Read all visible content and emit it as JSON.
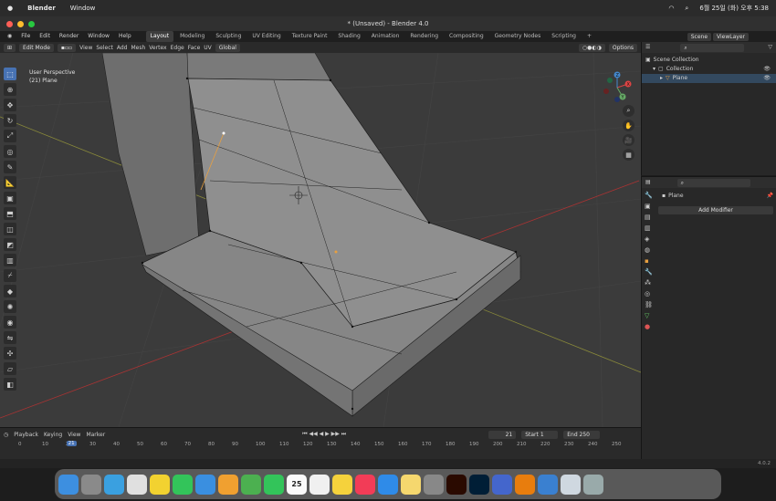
{
  "mac_menu": {
    "apple": "",
    "app": "Blender",
    "window": "Window",
    "clock": "6월 25일 (화) 오후 5:38"
  },
  "window_title": "* (Unsaved) - Blender 4.0",
  "menus": [
    "File",
    "Edit",
    "Render",
    "Window",
    "Help"
  ],
  "workspaces": [
    "Layout",
    "Modeling",
    "Sculpting",
    "UV Editing",
    "Texture Paint",
    "Shading",
    "Animation",
    "Rendering",
    "Compositing",
    "Geometry Nodes",
    "Scripting"
  ],
  "active_workspace": "Layout",
  "scene": "Scene",
  "view_layer": "ViewLayer",
  "header": {
    "mode": "Edit Mode",
    "view": "View",
    "select": "Select",
    "add": "Add",
    "mesh": "Mesh",
    "vertex": "Vertex",
    "edge": "Edge",
    "face": "Face",
    "uv": "UV",
    "orientation": "Global",
    "options": "Options"
  },
  "viewport": {
    "line1": "User Perspective",
    "line2": "(21) Plane",
    "axes": {
      "x": "X",
      "y": "Y",
      "z": "Z"
    }
  },
  "outliner": {
    "scene_collection": "Scene Collection",
    "collection": "Collection",
    "plane": "Plane"
  },
  "properties": {
    "object": "Plane",
    "add_modifier": "Add Modifier"
  },
  "timeline": {
    "playback": "Playback",
    "keying": "Keying",
    "view": "View",
    "marker": "Marker",
    "current": "21",
    "start_label": "Start",
    "start": "1",
    "end_label": "End",
    "end": "250",
    "ticks": [
      "0",
      "10",
      "20",
      "30",
      "40",
      "50",
      "60",
      "70",
      "80",
      "90",
      "100",
      "110",
      "120",
      "130",
      "140",
      "150",
      "160",
      "170",
      "180",
      "190",
      "200",
      "210",
      "220",
      "230",
      "240",
      "250"
    ],
    "playhead": "21"
  },
  "status": {
    "version": "4.0.2"
  },
  "dock": [
    "Finder",
    "Launchpad",
    "Safari",
    "Chrome",
    "KakaoTalk",
    "Messages",
    "Mail",
    "Photos",
    "Maps",
    "FaceTime",
    "Calendar",
    "Reminders",
    "Notes",
    "Music",
    "App Store",
    "Stickies",
    "System Settings",
    "Illustrator",
    "Photoshop",
    "Files",
    "Blender",
    "Weather",
    "Preview",
    "Trash"
  ],
  "dock_calendar_day": "25"
}
